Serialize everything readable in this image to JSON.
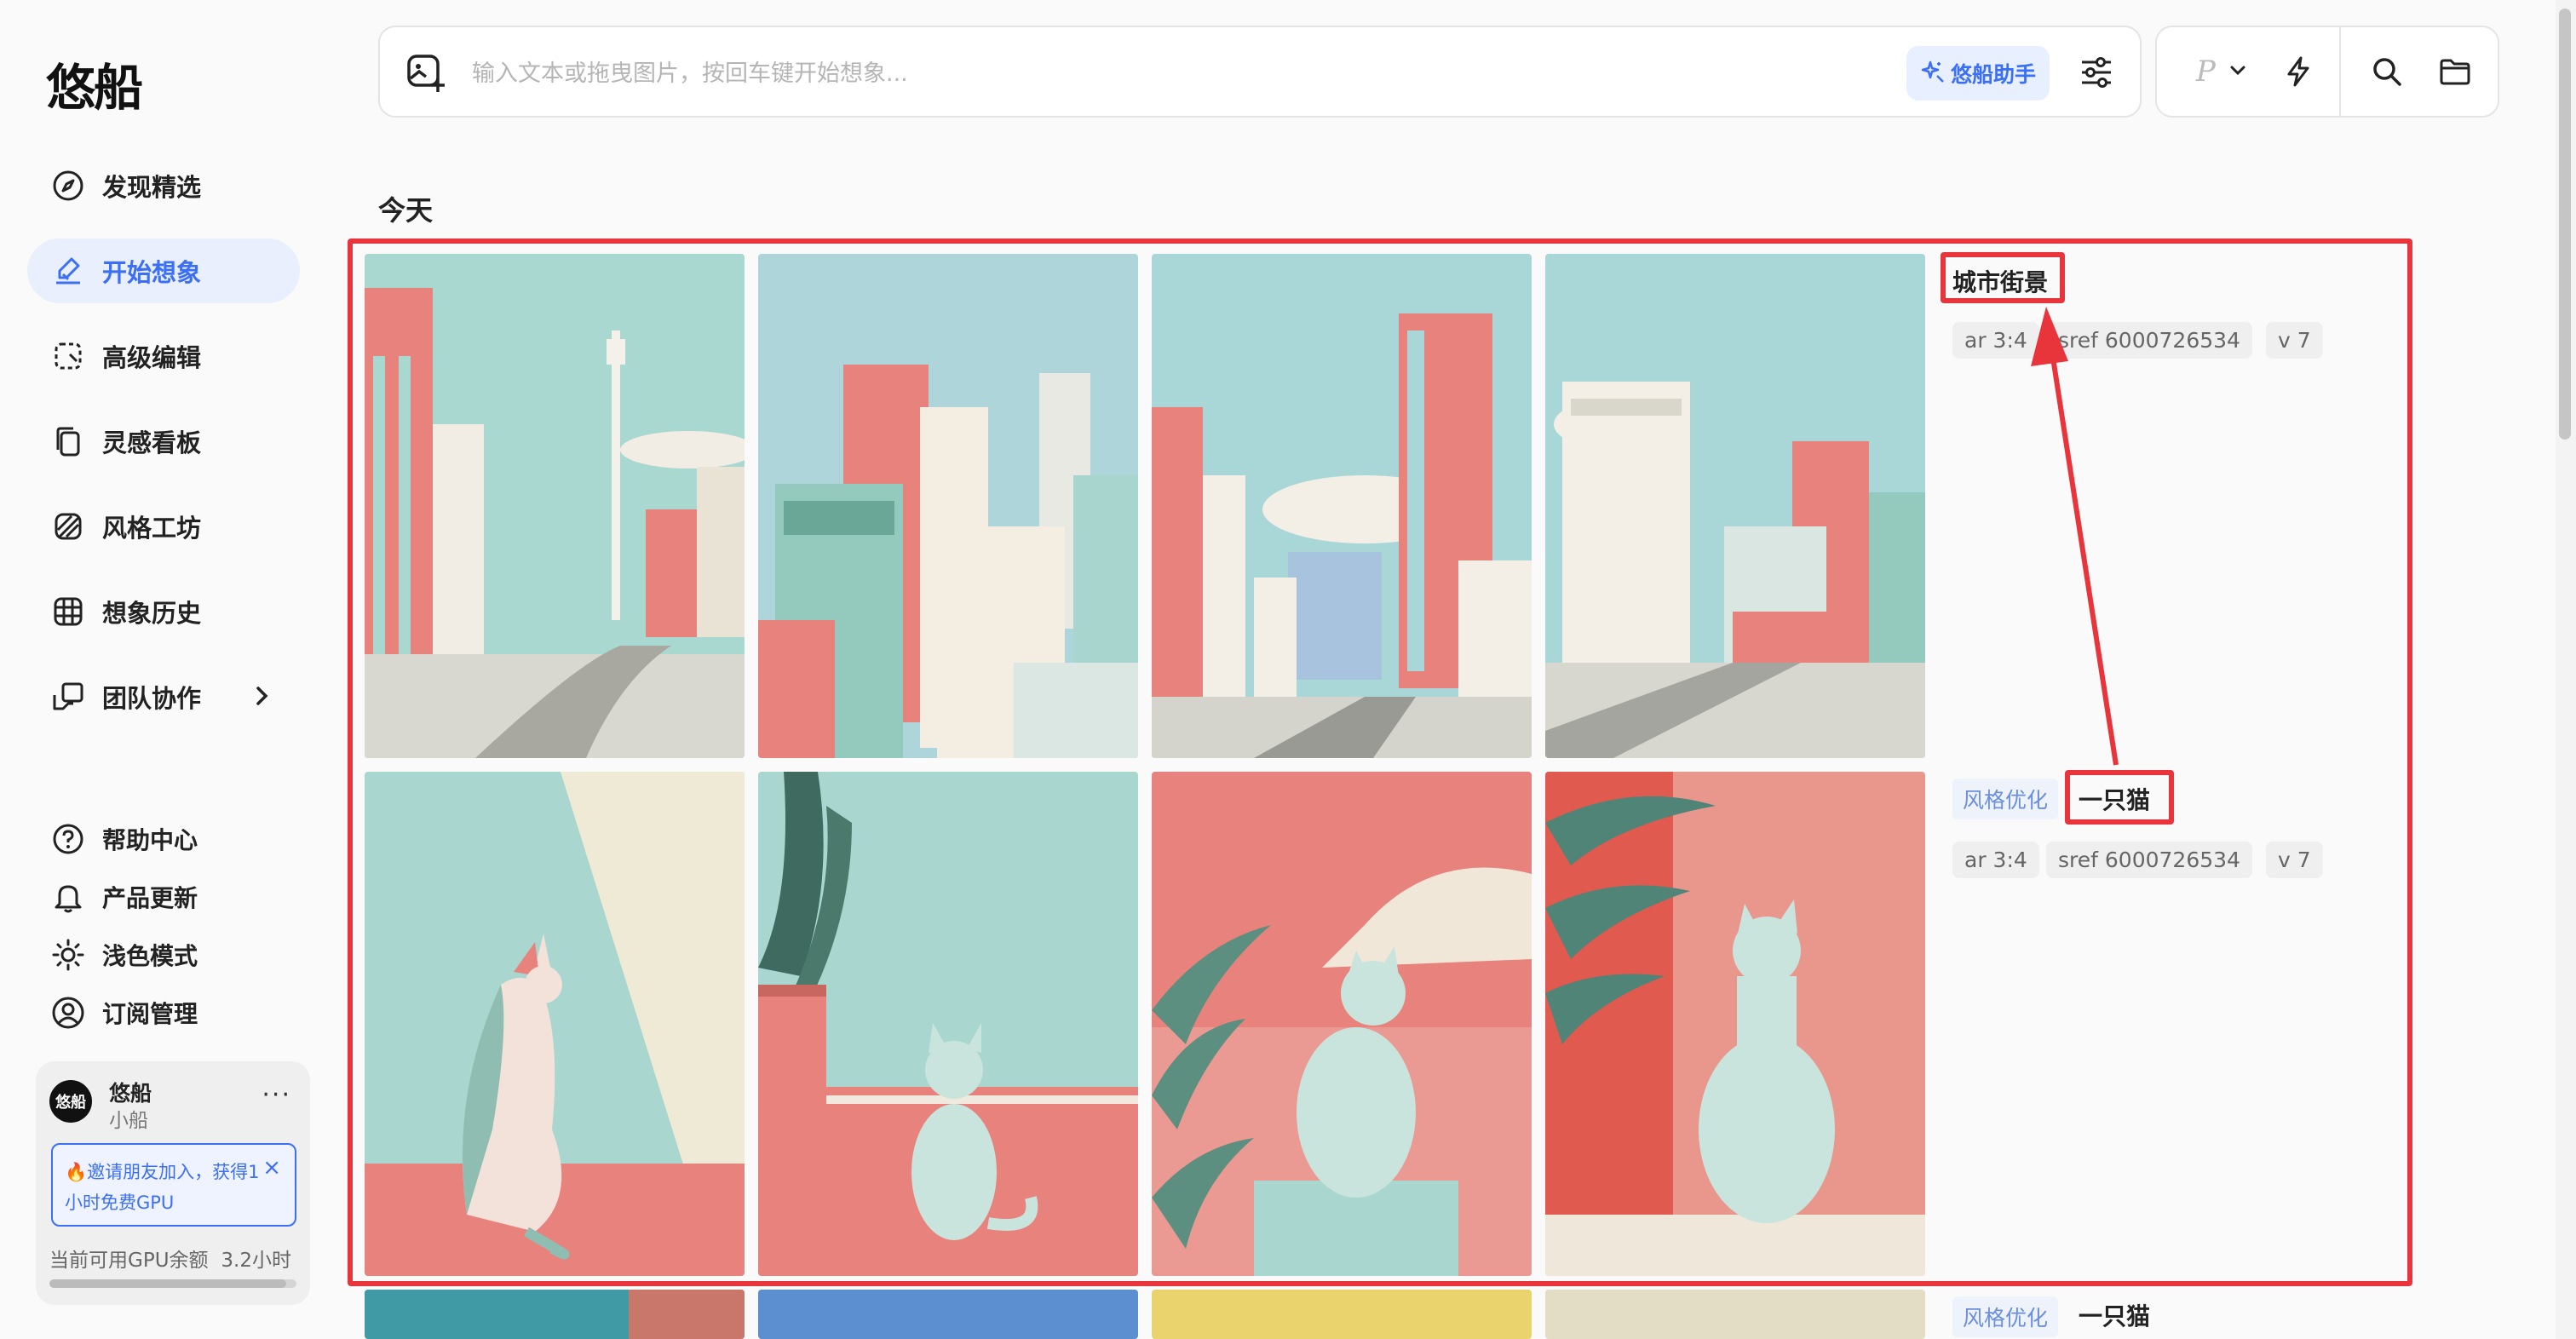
{
  "app": {
    "logo_text": "悠船"
  },
  "sidebar": {
    "nav": [
      {
        "label": "发现精选",
        "icon": "compass-icon"
      },
      {
        "label": "开始想象",
        "icon": "brush-icon",
        "active": true
      },
      {
        "label": "高级编辑",
        "icon": "edit-crop-icon"
      },
      {
        "label": "灵感看板",
        "icon": "cards-icon"
      },
      {
        "label": "风格工坊",
        "icon": "style-icon"
      },
      {
        "label": "想象历史",
        "icon": "grid-icon"
      },
      {
        "label": "团队协作",
        "icon": "team-icon"
      }
    ],
    "utilities": [
      {
        "label": "帮助中心",
        "icon": "help-circle-icon"
      },
      {
        "label": "产品更新",
        "icon": "bell-icon"
      },
      {
        "label": "浅色模式",
        "icon": "sun-icon"
      },
      {
        "label": "订阅管理",
        "icon": "user-circle-icon"
      }
    ],
    "user": {
      "avatar_text": "悠船",
      "name": "悠船",
      "plan": "小船",
      "more": "···",
      "invite_text": "🔥邀请朋友加入，获得1小时免费GPU",
      "close": "×",
      "gpu_label": "当前可用GPU余额",
      "gpu_value": "3.2小时"
    }
  },
  "prompt_bar": {
    "placeholder": "输入文本或拖曳图片，按回车键开始想象...",
    "value": "",
    "assistant_label": "悠船助手"
  },
  "tools": {
    "model_letter": "P"
  },
  "feed": {
    "day": "今天",
    "groups": [
      {
        "title": "城市街景",
        "style_tag": "",
        "params": [
          "ar 3:4",
          "sref 6000726534",
          "v 7"
        ],
        "images": [
          "city-street-image-1",
          "city-street-image-2",
          "city-street-image-3",
          "city-street-image-4"
        ]
      },
      {
        "title": "一只猫",
        "style_tag": "风格优化",
        "params": [
          "ar 3:4",
          "sref 6000726534",
          "v 7"
        ],
        "images": [
          "cat-image-1",
          "cat-image-2",
          "cat-image-3",
          "cat-image-4"
        ]
      },
      {
        "title": "一只猫",
        "style_tag": "风格优化",
        "params": [],
        "images": [
          "image-1",
          "image-2",
          "image-3",
          "image-4"
        ]
      }
    ]
  },
  "colors": {
    "accent": "#3b6ff5",
    "annotation_red": "#e8343b",
    "mint": "#a8d8d0",
    "coral": "#e8807a"
  }
}
